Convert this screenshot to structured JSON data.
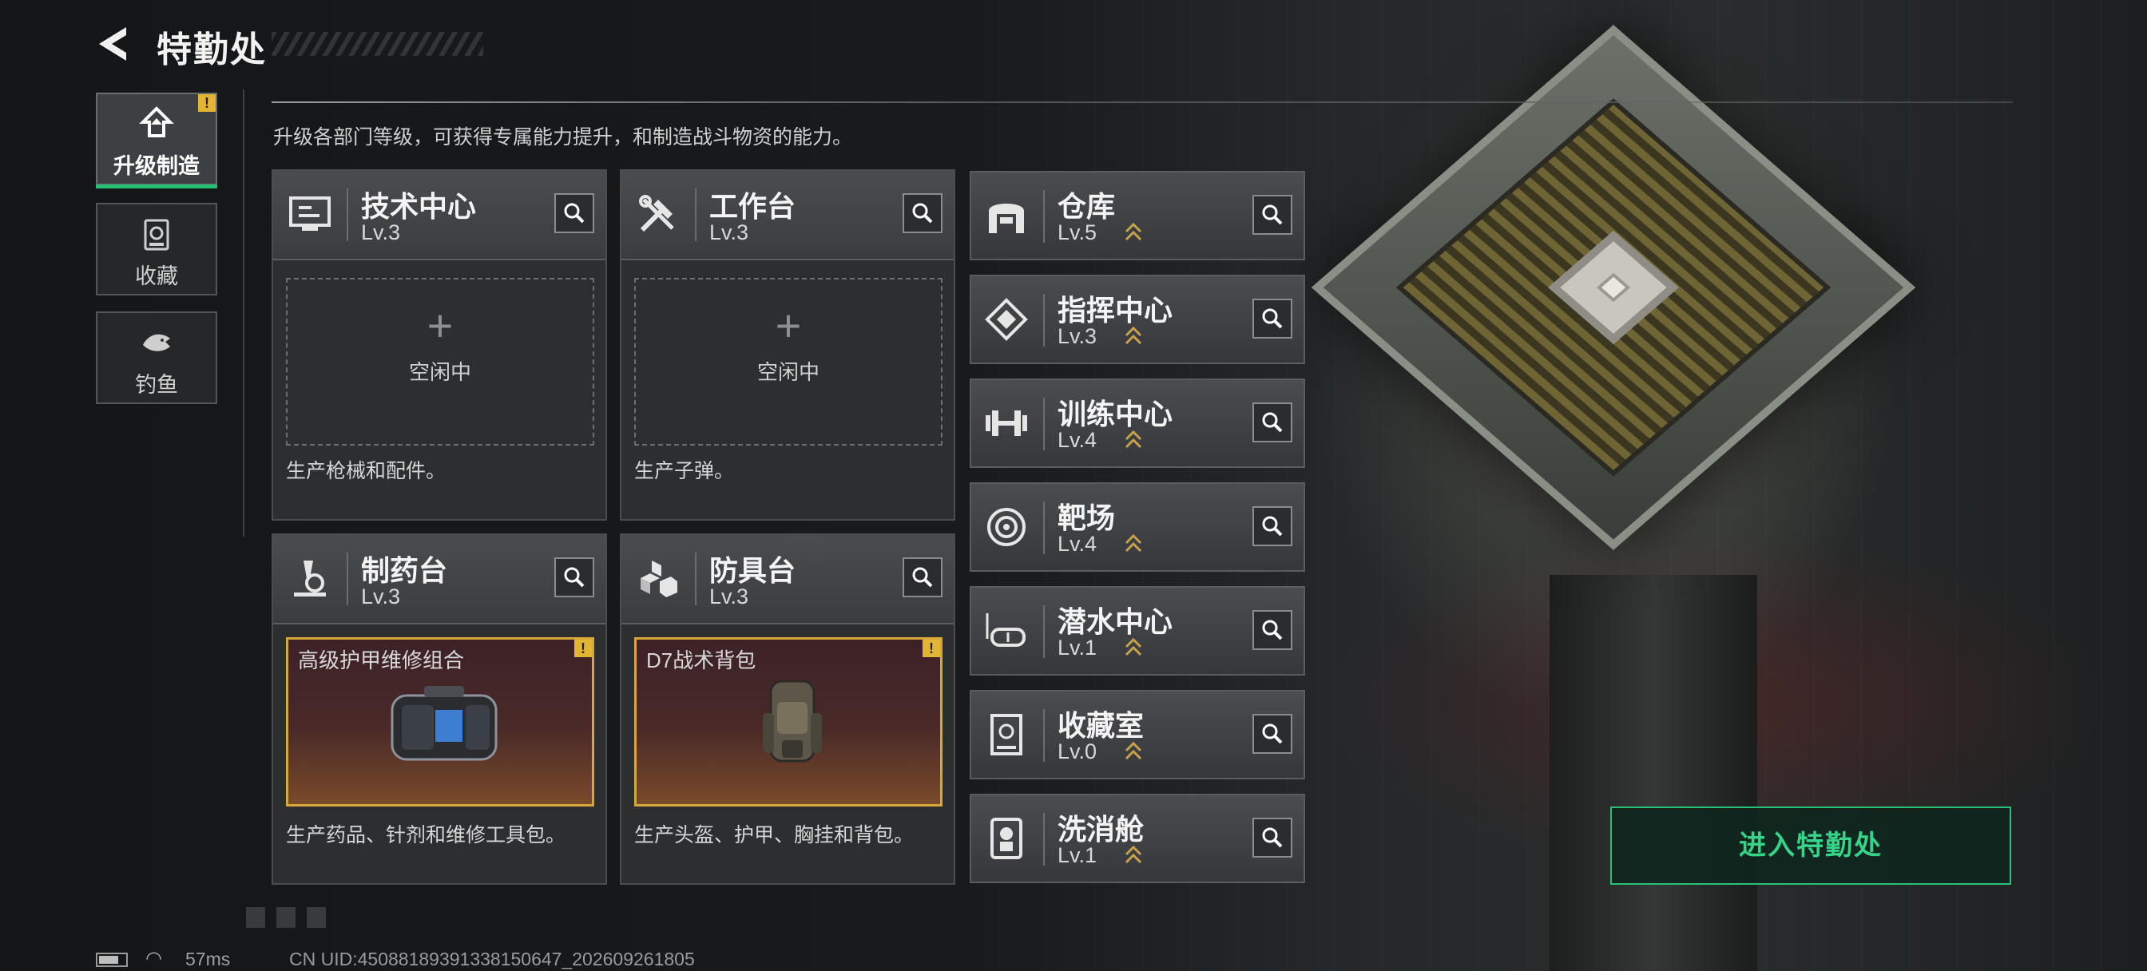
{
  "header": {
    "title": "特勤处",
    "subtitle": "升级各部门等级，可获得专属能力提升，和制造战斗物资的能力。"
  },
  "tabs": [
    {
      "label": "升级制造",
      "icon": "upgrade-icon",
      "active": true,
      "badge": "!"
    },
    {
      "label": "收藏",
      "icon": "collection-icon",
      "active": false
    },
    {
      "label": "钓鱼",
      "icon": "fish-icon",
      "active": false
    }
  ],
  "cards": {
    "tech": {
      "name": "技术中心",
      "level": "Lv.3",
      "idle": "空闲中",
      "desc": "生产枪械和配件。",
      "icon": "monitor-icon"
    },
    "workbench": {
      "name": "工作台",
      "level": "Lv.3",
      "idle": "空闲中",
      "desc": "生产子弹。",
      "icon": "tools-icon"
    },
    "pharmacy": {
      "name": "制药台",
      "level": "Lv.3",
      "product": "高级护甲维修组合",
      "badge": "!",
      "desc": "生产药品、针剂和维修工具包。",
      "icon": "microscope-icon"
    },
    "armor": {
      "name": "防具台",
      "level": "Lv.3",
      "product": "D7战术背包",
      "badge": "!",
      "desc": "生产头盔、护甲、胸挂和背包。",
      "icon": "boxes-icon"
    }
  },
  "idle_plus": "+",
  "departments": [
    {
      "name": "仓库",
      "level": "Lv.5",
      "icon": "warehouse-icon"
    },
    {
      "name": "指挥中心",
      "level": "Lv.3",
      "icon": "command-icon"
    },
    {
      "name": "训练中心",
      "level": "Lv.4",
      "icon": "dumbbell-icon"
    },
    {
      "name": "靶场",
      "level": "Lv.4",
      "icon": "target-icon"
    },
    {
      "name": "潜水中心",
      "level": "Lv.1",
      "icon": "diving-mask-icon"
    },
    {
      "name": "收藏室",
      "level": "Lv.0",
      "icon": "trophy-case-icon"
    },
    {
      "name": "洗消舱",
      "level": "Lv.1",
      "icon": "decon-icon"
    }
  ],
  "enter_button": "进入特勤处",
  "status": {
    "ping": "57ms",
    "uid": "CN UID:4508818939133815​0647_202609261805"
  },
  "colors": {
    "accent": "#2dbf78",
    "badge": "#e2b532",
    "product_border": "#d8a73a"
  }
}
